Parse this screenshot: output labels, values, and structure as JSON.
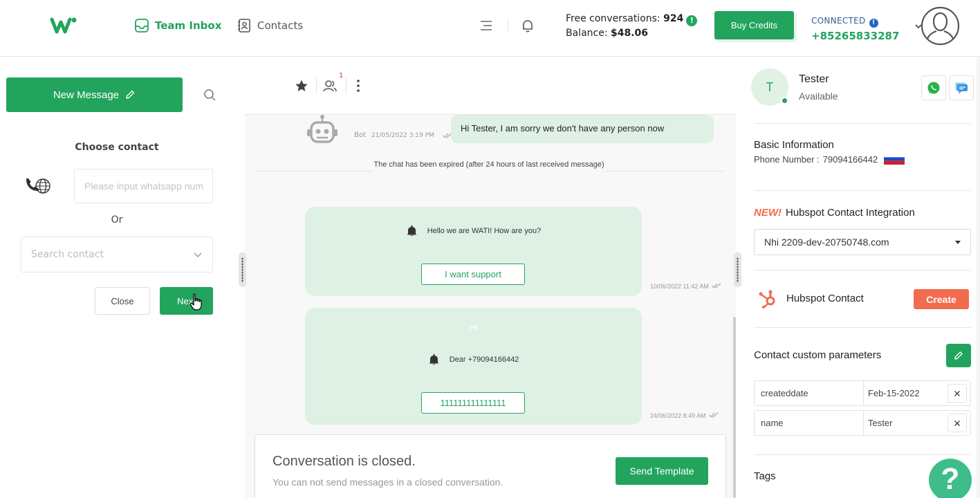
{
  "header": {
    "nav_team_inbox": "Team Inbox",
    "nav_contacts": "Contacts",
    "free_conversations_label": "Free conversations:",
    "free_conversations_value": "924",
    "balance_label": "Balance:",
    "balance_value": "$48.06",
    "buy_credits": "Buy Credits",
    "connected_label": "CONNECTED",
    "connected_number": "+85265833287",
    "info_mark": "!",
    "accent_color": "#22a45d"
  },
  "left_panel": {
    "new_message": "New Message",
    "choose_contact": "Choose contact",
    "whatsapp_placeholder": "Please input whatsapp number",
    "or": "Or",
    "search_contact_placeholder": "Search contact",
    "close": "Close",
    "next": "Next"
  },
  "chat": {
    "participants_badge": "1",
    "bot_sender": "Bot",
    "bot_time": "21/05/2022 3:19 PM",
    "bot_message": "Hi Tester, I am sorry we don't have any person now",
    "expired_notice": "The chat has been expired (after 24 hours of last received message)",
    "template1": {
      "text": "Hello we are WATI! How are you?",
      "button": "I want support",
      "time": "10/06/2022 11:42 AM"
    },
    "template2": {
      "header": "HI",
      "text": "Dear +79094166442",
      "button": "111111111111111",
      "time": "24/06/2022 8:49 AM"
    },
    "closed_title": "Conversation is closed.",
    "closed_sub": "You can not send messages in a closed conversation.",
    "send_template": "Send Template"
  },
  "right_panel": {
    "avatar_initial": "T",
    "name": "Tester",
    "status": "Available",
    "basic_info_title": "Basic Information",
    "phone_label": "Phone Number :",
    "phone_value": "79094166442",
    "new_tag": "NEW!",
    "hubspot_integration_title": "Hubspot Contact Integration",
    "hubspot_selected": "Nhi 2209-dev-20750748.com",
    "hubspot_contact": "Hubspot Contact",
    "create": "Create",
    "custom_params_title": "Contact custom parameters",
    "params": [
      {
        "key": "createddate",
        "value": "Feb-15-2022"
      },
      {
        "key": "name",
        "value": "Tester"
      }
    ],
    "tags_title": "Tags",
    "help": "?"
  }
}
